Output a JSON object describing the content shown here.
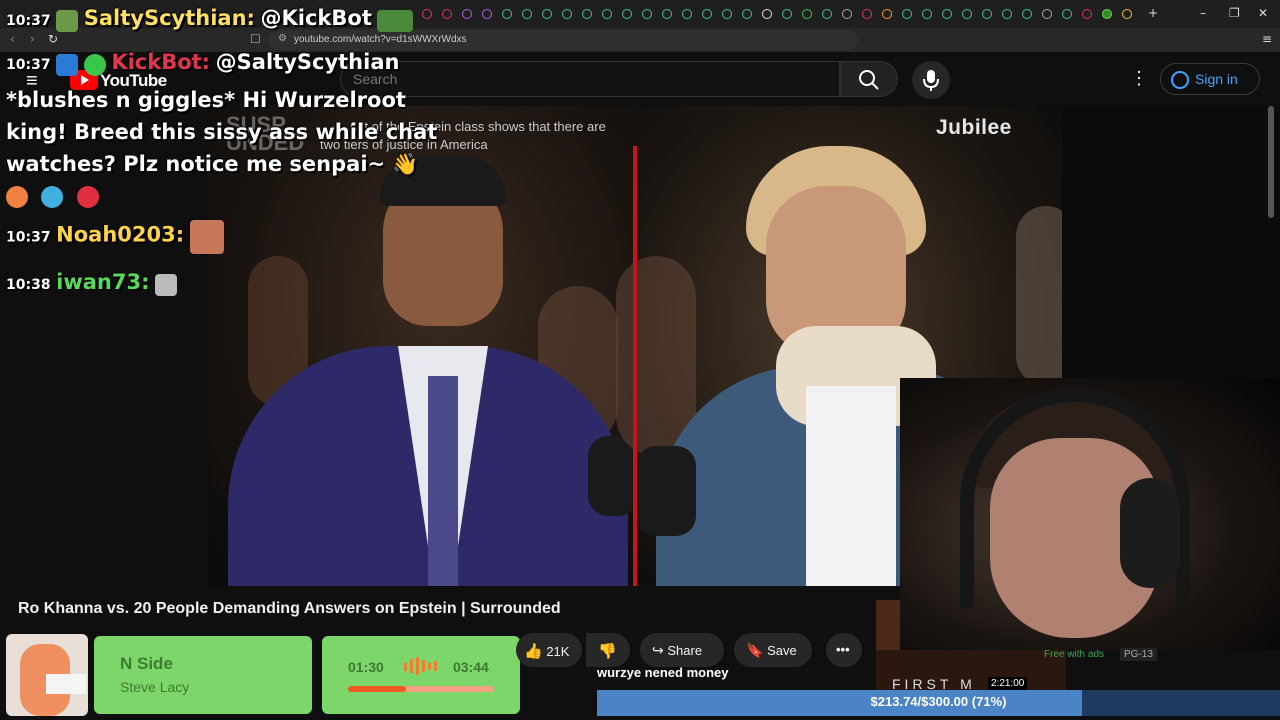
{
  "browser": {
    "url": "youtube.com/watch?v=d1sWWXrWdxs"
  },
  "youtube": {
    "logo": "YouTube",
    "search_placeholder": "Search",
    "sign_in": "Sign in"
  },
  "video": {
    "title": "Ro Khanna vs. 20 People Demanding Answers on Epstein | Surrounded",
    "watermark": "Jubilee",
    "caption_line1": "ent of the Epstein class shows that there are",
    "caption_line2": "two tiers of justice in America",
    "banner_line1": "SUSP",
    "banner_line2": "UNDED",
    "likes": "21K",
    "share": "Share",
    "save": "Save"
  },
  "chat": {
    "messages": [
      {
        "time": "10:37",
        "user": "SaltyScythian:",
        "user_color": "#ffe066",
        "text": "@KickBot"
      },
      {
        "time": "10:37",
        "user": "KickBot:",
        "user_color": "#e0364e",
        "text": "@SaltyScythian"
      },
      {
        "time": "",
        "user": "",
        "user_color": "#ffffff",
        "text": "*blushes n giggles* Hi Wurzelroot"
      },
      {
        "time": "",
        "user": "",
        "user_color": "#ffffff",
        "text": "king! Breed this sissy ass while chat"
      },
      {
        "time": "",
        "user": "",
        "user_color": "#ffffff",
        "text": "watches? Plz notice me senpai~ 👋"
      },
      {
        "time": "10:37",
        "user": "Noah0203:",
        "user_color": "#ffd24d",
        "text": ""
      },
      {
        "time": "10:38",
        "user": "iwan73:",
        "user_color": "#5ad85a",
        "text": ""
      }
    ]
  },
  "song": {
    "name": "N Side",
    "artist": "Steve Lacy",
    "elapsed": "01:30",
    "total": "03:44",
    "progress": 0.4
  },
  "sidebar_card": {
    "badge": "Free with ads",
    "rating": "PG-13",
    "duration": "2:21:00",
    "poster_text": "FIRST M"
  },
  "overlay_text": "wurzye nened money",
  "donation": {
    "label": "$213.74/$300.00 (71%)",
    "progress": 0.71
  },
  "colors": {
    "accent_red": "#c4161c",
    "song_green": "#7dd66a",
    "donation_blue": "#4a84c4",
    "link_blue": "#3ea6ff"
  }
}
